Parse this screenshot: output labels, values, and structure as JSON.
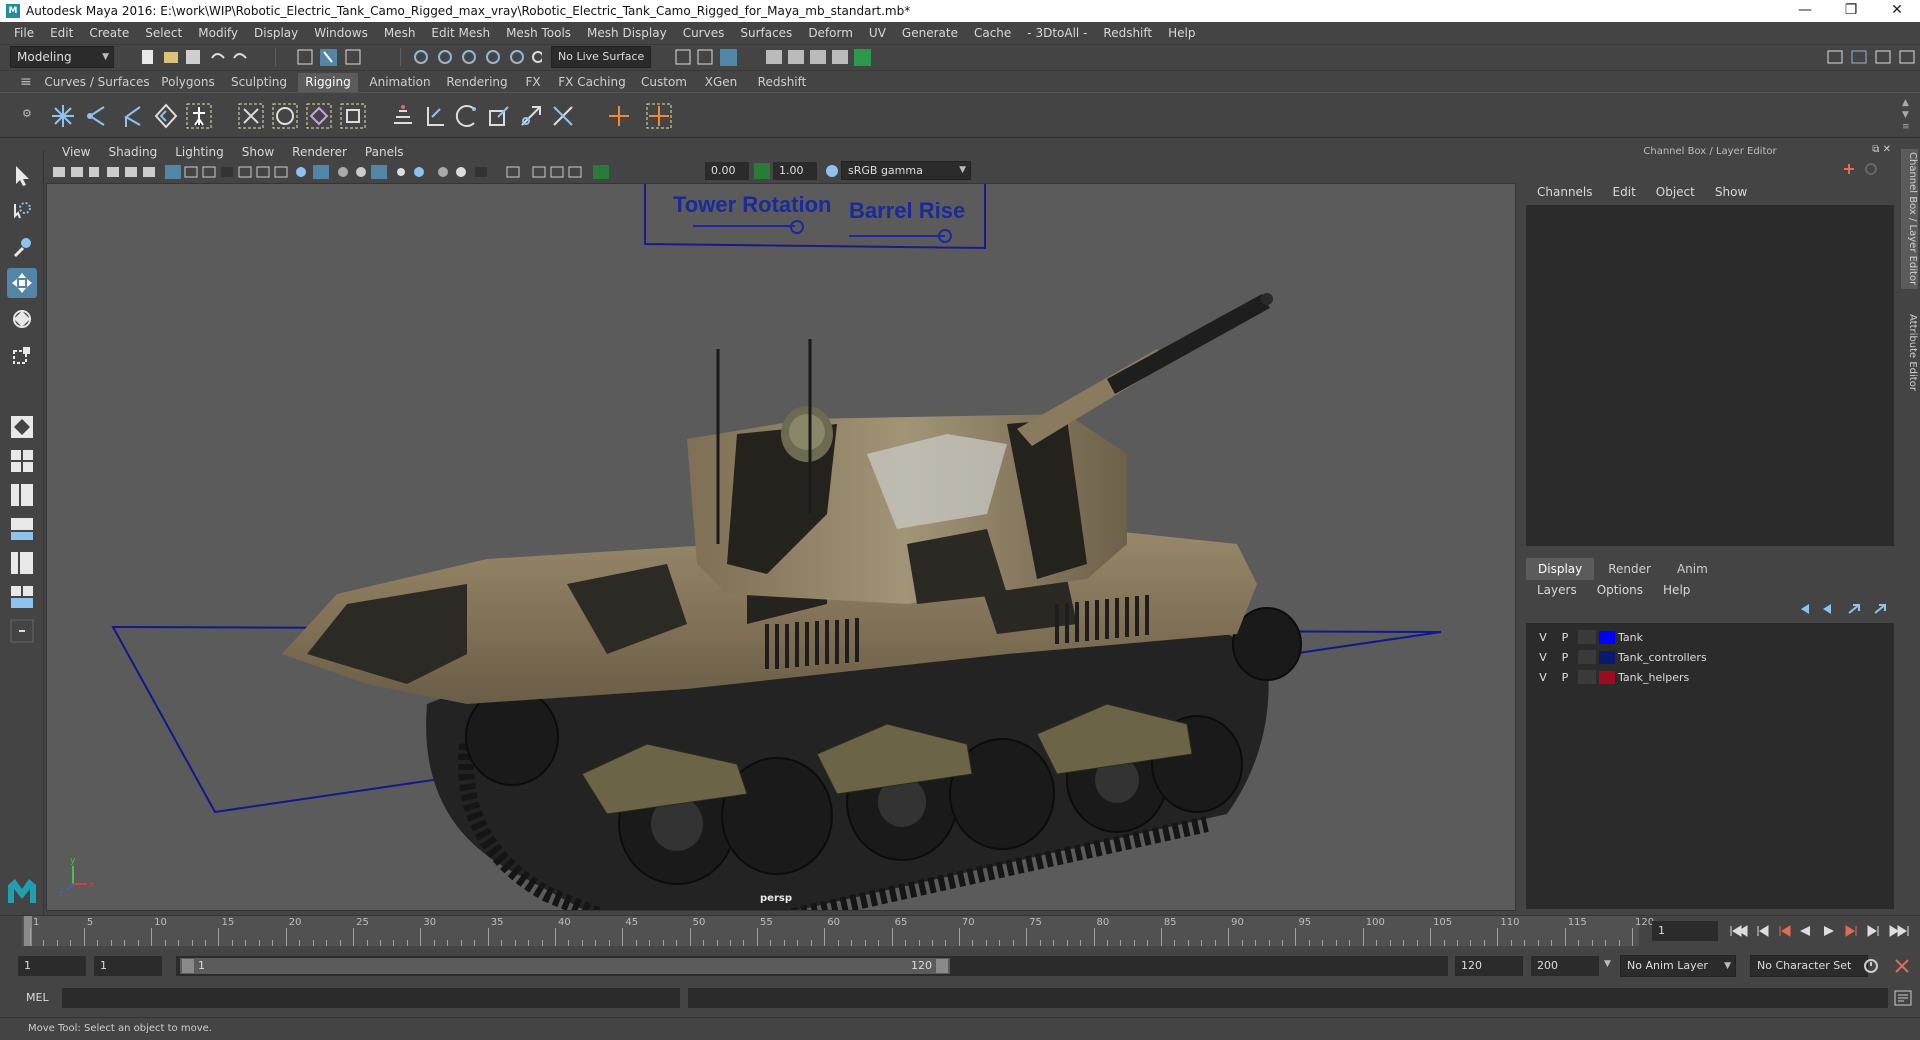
{
  "window": {
    "title": "Autodesk Maya 2016: E:\\work\\WIP\\Robotic_Electric_Tank_Camo_Rigged_max_vray\\Robotic_Electric_Tank_Camo_Rigged_for_Maya_mb_standart.mb*",
    "minimize": "—",
    "restore": "❐",
    "close": "✕"
  },
  "menu": [
    "File",
    "Edit",
    "Create",
    "Select",
    "Modify",
    "Display",
    "Windows",
    "Mesh",
    "Edit Mesh",
    "Mesh Tools",
    "Mesh Display",
    "Curves",
    "Surfaces",
    "Deform",
    "UV",
    "Generate",
    "Cache",
    "- 3DtoAll -",
    "Redshift",
    "Help"
  ],
  "statusline": {
    "mode": "Modeling",
    "live_surface": "No Live Surface"
  },
  "shelf_tabs": [
    "Curves / Surfaces",
    "Polygons",
    "Sculpting",
    "Rigging",
    "Animation",
    "Rendering",
    "FX",
    "FX Caching",
    "Custom",
    "XGen",
    "Redshift"
  ],
  "shelf_active_tab": "Rigging",
  "viewport_menu": [
    "View",
    "Shading",
    "Lighting",
    "Show",
    "Renderer",
    "Panels"
  ],
  "viewport_toolbar": {
    "exposure": "0.00",
    "gamma": "1.00",
    "colorspace": "sRGB gamma"
  },
  "viewport": {
    "camera_label": "persp",
    "controller_labels": [
      "Tower Rotation",
      "Barrel Rise"
    ],
    "axis_labels": [
      "y",
      "z",
      "x"
    ]
  },
  "channel_box": {
    "title": "Channel Box / Layer Editor",
    "menu": [
      "Channels",
      "Edit",
      "Object",
      "Show"
    ]
  },
  "layer_editor": {
    "tabs": [
      "Display",
      "Render",
      "Anim"
    ],
    "active_tab": "Display",
    "menu": [
      "Layers",
      "Options",
      "Help"
    ],
    "layers": [
      {
        "v": "V",
        "p": "P",
        "name": "Tank",
        "color": "#0000ff"
      },
      {
        "v": "V",
        "p": "P",
        "name": "Tank_controllers",
        "color": "#0b1870"
      },
      {
        "v": "V",
        "p": "P",
        "name": "Tank_helpers",
        "color": "#9b0c1e"
      }
    ]
  },
  "side_tabs": [
    "Channel Box / Layer Editor",
    "Attribute Editor"
  ],
  "time_slider": {
    "ticks": [
      "1",
      "5",
      "10",
      "15",
      "20",
      "25",
      "30",
      "35",
      "40",
      "45",
      "50",
      "55",
      "60",
      "65",
      "70",
      "75",
      "80",
      "85",
      "90",
      "95",
      "100",
      "105",
      "110",
      "115",
      "120"
    ],
    "current_frame": "1"
  },
  "range_slider": {
    "start": "1",
    "playback_start": "1",
    "range_start_label": "1",
    "range_end_label": "120",
    "playback_end": "120",
    "end": "200",
    "anim_layer": "No Anim Layer",
    "character_set": "No Character Set"
  },
  "command_line": {
    "label": "MEL"
  },
  "help_line": "Move Tool: Select an object to move."
}
